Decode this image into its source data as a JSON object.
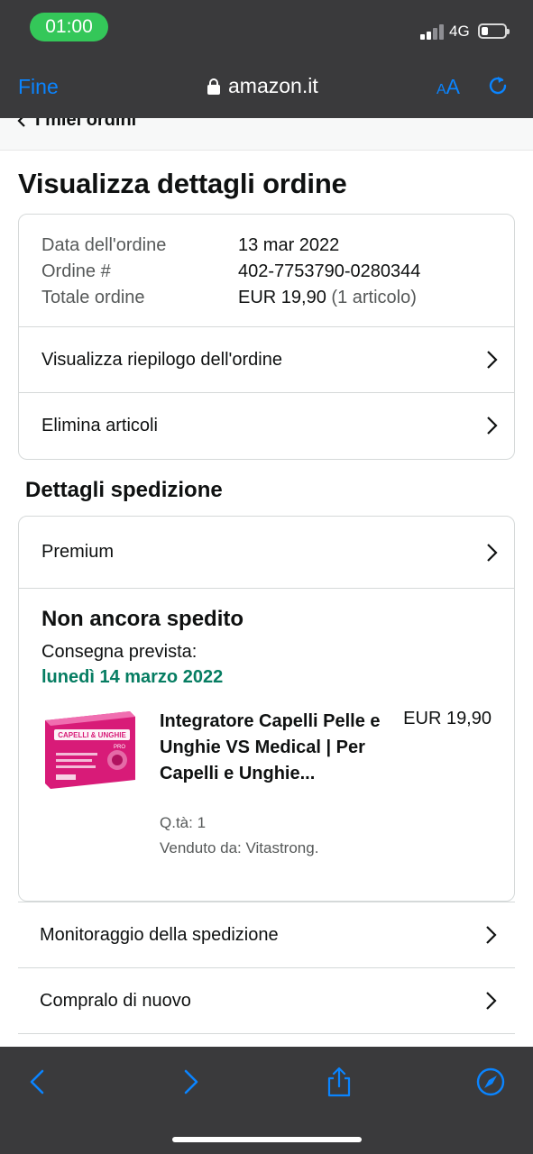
{
  "status_bar": {
    "time": "01:00",
    "network": "4G"
  },
  "browser": {
    "done_label": "Fine",
    "url": "amazon.it",
    "text_size": {
      "small": "A",
      "large": "A"
    }
  },
  "breadcrumb": {
    "label": "I miei ordini"
  },
  "page": {
    "title": "Visualizza dettagli ordine"
  },
  "order_summary": {
    "rows": [
      {
        "label": "Data dell'ordine",
        "value": "13 mar 2022"
      },
      {
        "label": "Ordine #",
        "value": "402-7753790-0280344"
      },
      {
        "label": "Totale ordine",
        "value": "EUR 19,90",
        "note": "(1 articolo)"
      }
    ],
    "links": [
      "Visualizza riepilogo dell'ordine",
      "Elimina articoli"
    ]
  },
  "shipping": {
    "section_title": "Dettagli spedizione",
    "method": "Premium",
    "status": "Non ancora spedito",
    "delivery_label": "Consegna prevista:",
    "delivery_date": "lunedì 14 marzo 2022",
    "item": {
      "name": "Integratore Capelli Pelle e Unghie VS Medical | Per Capelli e Unghie...",
      "price": "EUR 19,90",
      "qty": "Q.tà: 1",
      "seller": "Venduto da: Vitastrong.",
      "package_text": "CAPELLI & UNGHIE",
      "package_subtext": "PRO"
    }
  },
  "actions": [
    "Monitoraggio della spedizione",
    "Compralo di nuovo"
  ],
  "colors": {
    "accent": "#0a84ff",
    "delivery_green": "#067d62",
    "status_pill": "#34c759",
    "bar_bg": "#3a3a3c"
  }
}
